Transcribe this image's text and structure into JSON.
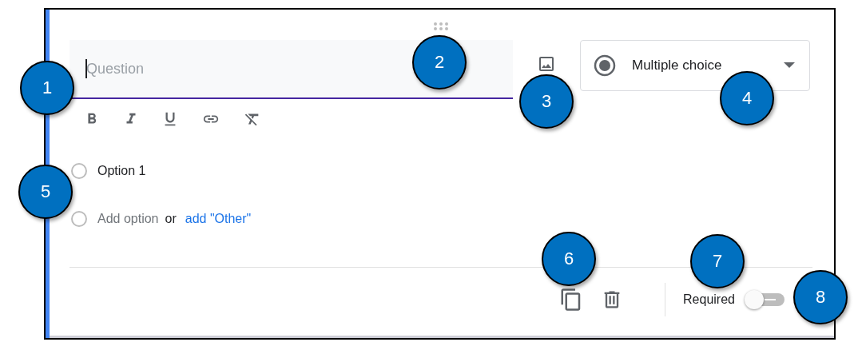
{
  "question": {
    "placeholder": "Question",
    "focused": true
  },
  "type_dropdown": {
    "value": "Multiple choice"
  },
  "options": [
    {
      "label": "Option 1",
      "checked": false
    }
  ],
  "add_option": {
    "checked": false,
    "placeholder": "Add option",
    "separator": "or",
    "other_link": "add \"Other\""
  },
  "footer": {
    "required_label": "Required",
    "required": false
  },
  "callouts": [
    {
      "label": "1"
    },
    {
      "label": "2"
    },
    {
      "label": "3"
    },
    {
      "label": "4"
    },
    {
      "label": "5"
    },
    {
      "label": "6"
    },
    {
      "label": "7"
    },
    {
      "label": "8"
    }
  ]
}
